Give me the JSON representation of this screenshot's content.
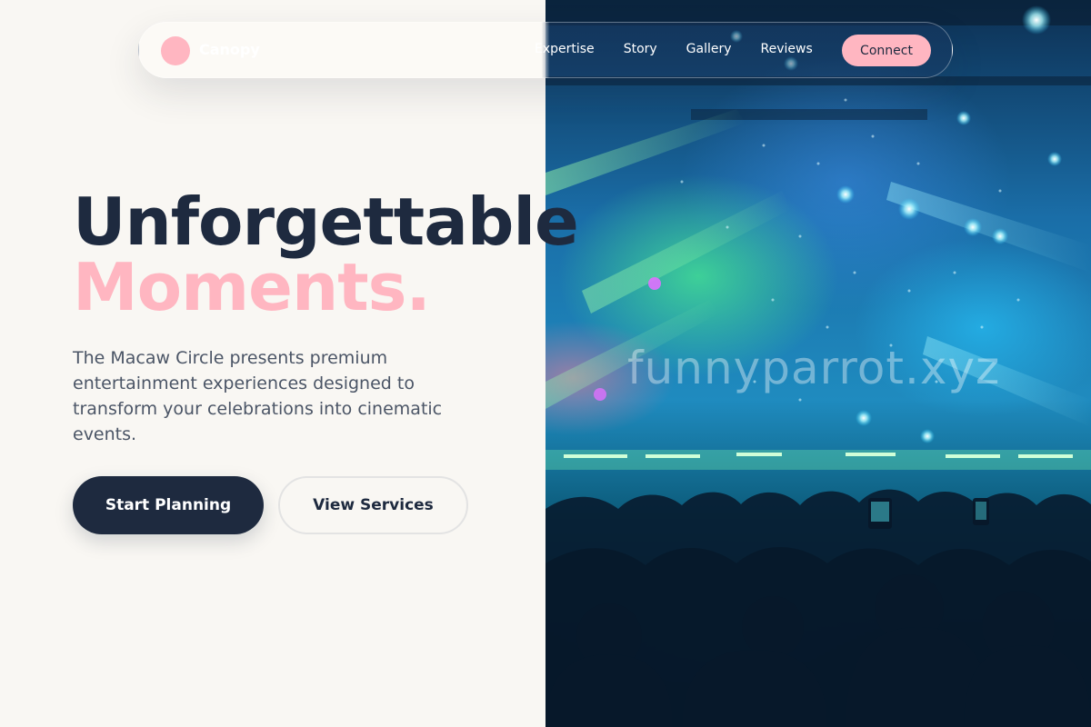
{
  "brand": {
    "name": "Canopy",
    "accent_color": "#ffb6c1",
    "dark_color": "#1e2a3f"
  },
  "nav": {
    "links": [
      "Expertise",
      "Story",
      "Gallery",
      "Reviews"
    ],
    "cta_label": "Connect"
  },
  "hero": {
    "headline_line1": "Unforgettable",
    "headline_line2": "Moments.",
    "description": "The Macaw Circle presents premium entertainment experiences designed to transform your celebrations into cinematic events.",
    "primary_cta": "Start Planning",
    "secondary_cta": "View Services"
  },
  "photo": {
    "subject": "concert crowd with stage lights",
    "watermark": "funnyparrot.xyz"
  }
}
